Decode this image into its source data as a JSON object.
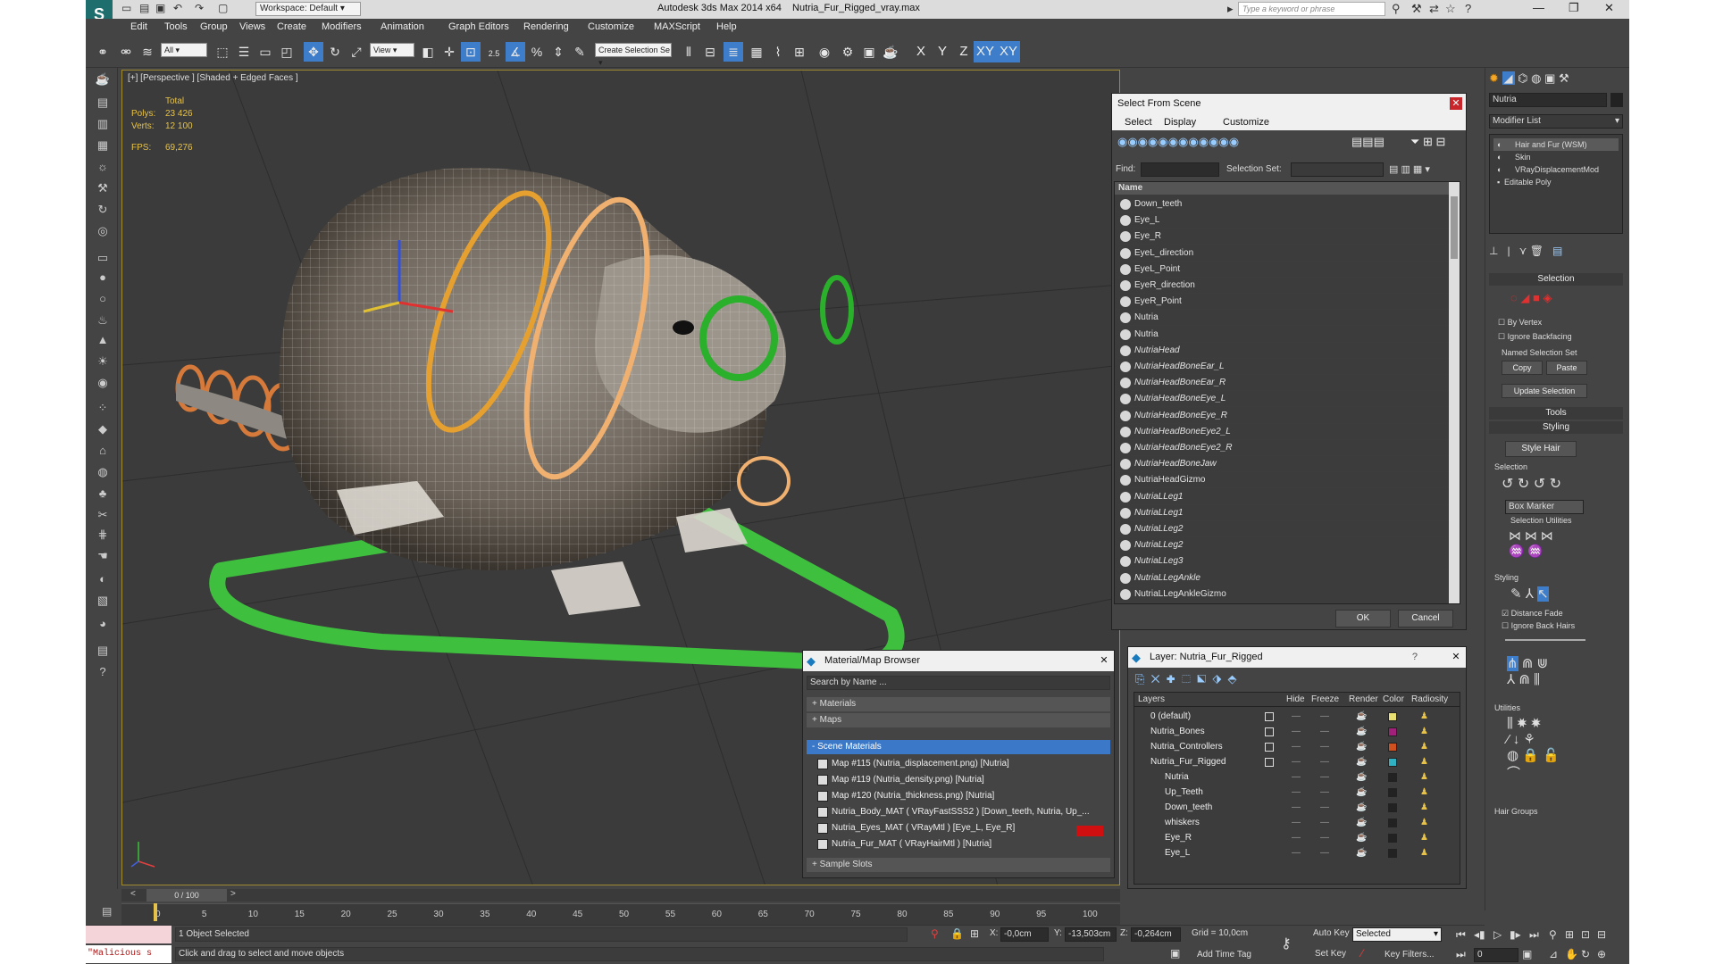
{
  "title": {
    "workspace": "Workspace: Default",
    "app": "Autodesk 3ds Max  2014 x64",
    "file": "Nutria_Fur_Rigged_vray.max",
    "search_placeholder": "Type a keyword or phrase"
  },
  "menu": [
    "Edit",
    "Tools",
    "Group",
    "Views",
    "Create",
    "Modifiers",
    "Animation",
    "Graph Editors",
    "Rendering",
    "Customize",
    "MAXScript",
    "Help"
  ],
  "toolbar": {
    "filter": "All",
    "view_ref": "View",
    "selection_set": "Create Selection Se",
    "axes": [
      "X",
      "Y",
      "Z",
      "XY",
      "XY"
    ],
    "snap_label": "2.5"
  },
  "viewport": {
    "label": "[+] [Perspective ] [Shaded + Edged Faces ]",
    "stats": {
      "total": "Total",
      "polys_label": "Polys:",
      "polys": "23 426",
      "verts_label": "Verts:",
      "verts": "12 100",
      "fps_label": "FPS:",
      "fps": "69,276"
    }
  },
  "select_from_scene": {
    "title": "Select From Scene",
    "menu": [
      "Select",
      "Display",
      "Customize"
    ],
    "find_label": "Find:",
    "selection_set_label": "Selection Set:",
    "column": "Name",
    "items": [
      {
        "n": "Down_teeth",
        "i": false
      },
      {
        "n": "Eye_L",
        "i": false
      },
      {
        "n": "Eye_R",
        "i": false
      },
      {
        "n": "EyeL_direction",
        "i": false
      },
      {
        "n": "EyeL_Point",
        "i": false
      },
      {
        "n": "EyeR_direction",
        "i": false
      },
      {
        "n": "EyeR_Point",
        "i": false
      },
      {
        "n": "Nutria",
        "i": false
      },
      {
        "n": "Nutria",
        "i": false
      },
      {
        "n": "NutriaHead",
        "i": true
      },
      {
        "n": "NutriaHeadBoneEar_L",
        "i": true
      },
      {
        "n": "NutriaHeadBoneEar_R",
        "i": true
      },
      {
        "n": "NutriaHeadBoneEye_L",
        "i": true
      },
      {
        "n": "NutriaHeadBoneEye_R",
        "i": true
      },
      {
        "n": "NutriaHeadBoneEye2_L",
        "i": true
      },
      {
        "n": "NutriaHeadBoneEye2_R",
        "i": true
      },
      {
        "n": "NutriaHeadBoneJaw",
        "i": true
      },
      {
        "n": "NutriaHeadGizmo",
        "i": false
      },
      {
        "n": "NutriaLLeg1",
        "i": true
      },
      {
        "n": "NutriaLLeg1",
        "i": true
      },
      {
        "n": "NutriaLLeg2",
        "i": true
      },
      {
        "n": "NutriaLLeg2",
        "i": true
      },
      {
        "n": "NutriaLLeg3",
        "i": true
      },
      {
        "n": "NutriaLLegAnkle",
        "i": true
      },
      {
        "n": "NutriaLLegAnkleGizmo",
        "i": false
      }
    ],
    "ok": "OK",
    "cancel": "Cancel"
  },
  "material_browser": {
    "title": "Material/Map Browser",
    "search": "Search by Name ...",
    "sections": [
      "+ Materials",
      "+ Maps",
      "- Scene Materials",
      "+ Sample Slots"
    ],
    "items": [
      "Map #115 (Nutria_displacement.png) [Nutria]",
      "Map #119 (Nutria_density.png) [Nutria]",
      "Map #120 (Nutria_thickness.png) [Nutria]",
      "Nutria_Body_MAT ( VRayFastSSS2 ) [Down_teeth, Nutria, Up_...",
      "Nutria_Eyes_MAT ( VRayMtl ) [Eye_L, Eye_R]",
      "Nutria_Fur_MAT ( VRayHairMtl ) [Nutria]"
    ]
  },
  "layer_manager": {
    "title": "Layer: Nutria_Fur_Rigged",
    "help": "?",
    "columns": [
      "Layers",
      "Hide",
      "Freeze",
      "Render",
      "Color",
      "Radiosity"
    ],
    "rows": [
      {
        "name": "0 (default)",
        "indent": 1,
        "color": "#e8e070"
      },
      {
        "name": "Nutria_Bones",
        "indent": 1,
        "color": "#a0207a"
      },
      {
        "name": "Nutria_Controllers",
        "indent": 1,
        "color": "#d05020"
      },
      {
        "name": "Nutria_Fur_Rigged",
        "indent": 1,
        "color": "#30b0c0"
      },
      {
        "name": "Nutria",
        "indent": 2,
        "color": "#222"
      },
      {
        "name": "Up_Teeth",
        "indent": 2,
        "color": "#222"
      },
      {
        "name": "Down_teeth",
        "indent": 2,
        "color": "#222"
      },
      {
        "name": "whiskers",
        "indent": 2,
        "color": "#222"
      },
      {
        "name": "Eye_R",
        "indent": 2,
        "color": "#222"
      },
      {
        "name": "Eye_L",
        "indent": 2,
        "color": "#222"
      }
    ]
  },
  "command_panel": {
    "object_name": "Nutria",
    "modifier_list": "Modifier List",
    "stack": [
      "Hair and Fur (WSM)",
      "Skin",
      "VRayDisplacementMod",
      "Editable Poly"
    ],
    "selection_rollout": "Selection",
    "by_vertex": "By Vertex",
    "ignore_backfacing": "Ignore Backfacing",
    "named_sel": "Named Selection Set",
    "copy": "Copy",
    "paste": "Paste",
    "update_sel": "Update Selection",
    "tools": "Tools",
    "styling": "Styling",
    "style_hair": "Style Hair",
    "selection2": "Selection",
    "box_marker": "Box Marker",
    "sel_utils": "Selection Utilities",
    "styling2": "Styling",
    "distance_fade": "Distance Fade",
    "ignore_back_hairs": "Ignore Back Hairs",
    "utilities": "Utilities",
    "hair_groups": "Hair Groups"
  },
  "timeline": {
    "frame": "0 / 100",
    "ticks": [
      "0",
      "5",
      "10",
      "15",
      "20",
      "25",
      "30",
      "35",
      "40",
      "45",
      "50",
      "55",
      "60",
      "65",
      "70",
      "75",
      "80",
      "85",
      "90",
      "95",
      "100"
    ]
  },
  "status": {
    "selected": "1 Object Selected",
    "hint": "Click and drag to select and move objects",
    "script": "\"Malicious s",
    "x_label": "X:",
    "x": "-0,0cm",
    "y_label": "Y:",
    "y": "-13,503cm",
    "z_label": "Z:",
    "z": "-0,264cm",
    "grid": "Grid = 10,0cm",
    "add_time_tag": "Add Time Tag",
    "auto_key": "Auto Key",
    "set_key": "Set Key",
    "key_mode": "Selected",
    "key_filters": "Key Filters...",
    "frame_field": "0"
  }
}
